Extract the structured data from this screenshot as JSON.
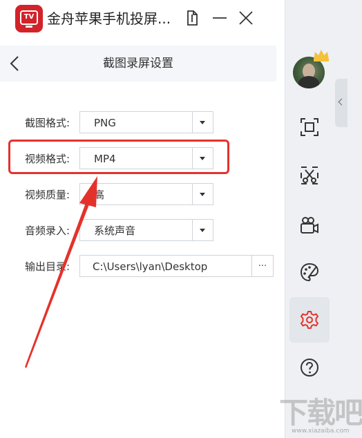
{
  "app": {
    "title": "金舟苹果手机投屏...",
    "logo_text": "TV"
  },
  "panel": {
    "title": "截图录屏设置"
  },
  "settings": {
    "screenshot_format": {
      "label": "截图格式:",
      "value": "PNG"
    },
    "video_format": {
      "label": "视频格式:",
      "value": "MP4"
    },
    "video_quality": {
      "label": "视频质量:",
      "value": "高"
    },
    "audio_input": {
      "label": "音频录入:",
      "value": "系统声音"
    },
    "output_dir": {
      "label": "输出目录:",
      "value": "C:\\Users\\lyan\\Desktop",
      "browse_label": "..."
    }
  },
  "sidebar": {
    "items": [
      {
        "name": "screenshot",
        "icon": "crop-frame-icon"
      },
      {
        "name": "cut",
        "icon": "scissors-icon"
      },
      {
        "name": "record",
        "icon": "video-camera-icon"
      },
      {
        "name": "theme",
        "icon": "palette-icon"
      },
      {
        "name": "settings",
        "icon": "gear-icon",
        "active": true
      },
      {
        "name": "help",
        "icon": "help-icon"
      }
    ]
  },
  "watermark": {
    "text": "下载吧",
    "url": "www.xiazaiba.com"
  },
  "colors": {
    "brand": "#d2232a",
    "highlight": "#e4322b",
    "settings_icon": "#e4322b"
  }
}
